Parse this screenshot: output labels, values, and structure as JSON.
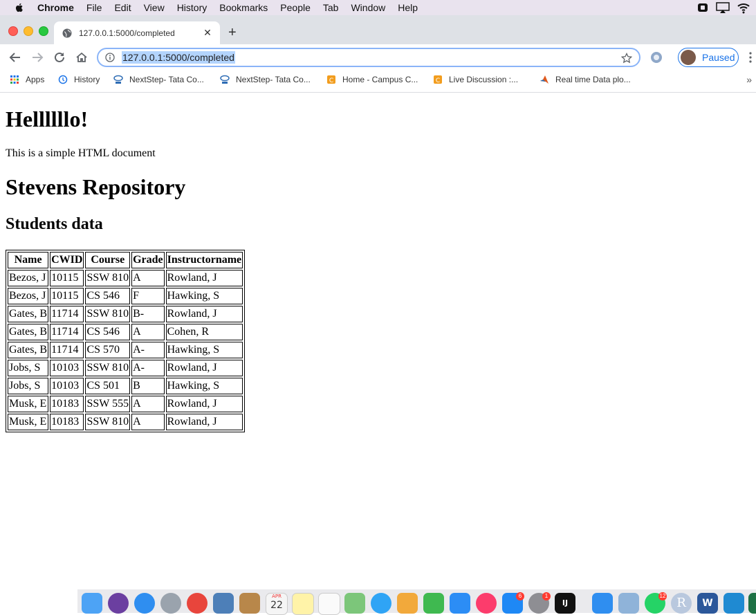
{
  "menubar": {
    "app": "Chrome",
    "items": [
      "File",
      "Edit",
      "View",
      "History",
      "Bookmarks",
      "People",
      "Tab",
      "Window",
      "Help"
    ]
  },
  "tab": {
    "title": "127.0.0.1:5000/completed"
  },
  "omnibox": {
    "url": "127.0.0.1:5000/completed"
  },
  "profile": {
    "label": "Paused"
  },
  "bookmarks": [
    {
      "label": "Apps",
      "icon": "apps-grid-icon",
      "color": "#1a73e8"
    },
    {
      "label": "History",
      "icon": "history-icon",
      "color": "#1a73e8"
    },
    {
      "label": "NextStep- Tata Co...",
      "icon": "tata-logo-icon",
      "color": "#2f6db5"
    },
    {
      "label": "NextStep- Tata Co...",
      "icon": "tata-logo-icon",
      "color": "#2f6db5"
    },
    {
      "label": "Home - Campus C...",
      "icon": "campus-icon",
      "color": "#f29d1e"
    },
    {
      "label": "Live Discussion :...",
      "icon": "campus-icon",
      "color": "#f29d1e"
    },
    {
      "label": "Real time Data plo...",
      "icon": "matlab-icon",
      "color": "#e0581c"
    }
  ],
  "page": {
    "heading1": "Hellllllo!",
    "paragraph": "This is a simple HTML document",
    "heading2": "Stevens Repository",
    "subheading": "Students data",
    "table": {
      "headers": [
        "Name",
        "CWID",
        "Course",
        "Grade",
        "Instructorname"
      ],
      "rows": [
        [
          "Bezos, J",
          "10115",
          "SSW 810",
          "A",
          "Rowland, J"
        ],
        [
          "Bezos, J",
          "10115",
          "CS 546",
          "F",
          "Hawking, S"
        ],
        [
          "Gates, B",
          "11714",
          "SSW 810",
          "B-",
          "Rowland, J"
        ],
        [
          "Gates, B",
          "11714",
          "CS 546",
          "A",
          "Cohen, R"
        ],
        [
          "Gates, B",
          "11714",
          "CS 570",
          "A-",
          "Hawking, S"
        ],
        [
          "Jobs, S",
          "10103",
          "SSW 810",
          "A-",
          "Rowland, J"
        ],
        [
          "Jobs, S",
          "10103",
          "CS 501",
          "B",
          "Hawking, S"
        ],
        [
          "Musk, E",
          "10183",
          "SSW 555",
          "A",
          "Rowland, J"
        ],
        [
          "Musk, E",
          "10183",
          "SSW 810",
          "A",
          "Rowland, J"
        ]
      ]
    }
  },
  "dock": {
    "calendar_month": "APR",
    "calendar_day": "22",
    "badges": {
      "app_store": "6",
      "system_prefs": "1",
      "whatsapp": "12"
    },
    "intellij_label": "IJ",
    "r_label": "R",
    "word_label": "W"
  }
}
